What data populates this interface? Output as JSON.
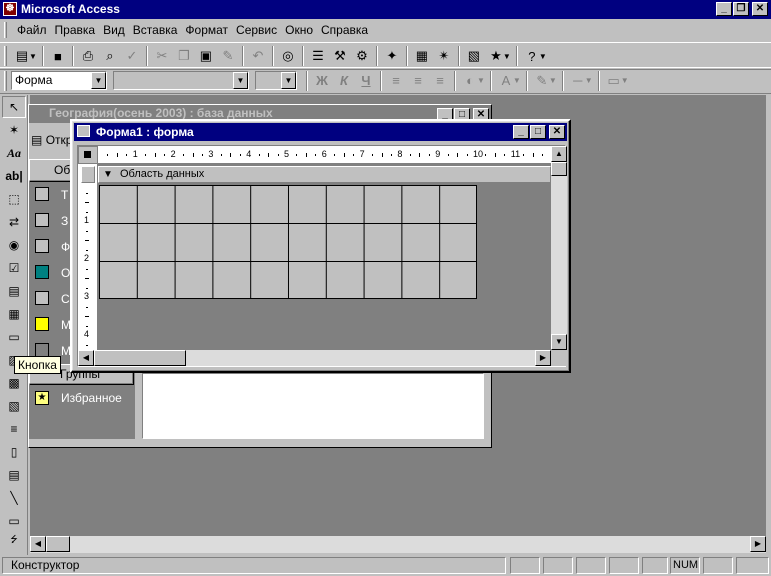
{
  "app": {
    "title": "Microsoft Access"
  },
  "menu": [
    "Файл",
    "Правка",
    "Вид",
    "Вставка",
    "Формат",
    "Сервис",
    "Окно",
    "Справка"
  ],
  "format_toolbar": {
    "object_combo": "Форма",
    "font_combo": "",
    "size_combo": "",
    "bold": "Ж",
    "italic": "К",
    "underline": "Ч"
  },
  "db_window": {
    "title": "География(осень 2003) : база данных",
    "open_button": "Откр",
    "objects_header": "Об",
    "objects": [
      "Т",
      "З",
      "Ф",
      "О",
      "С",
      "М",
      "М"
    ],
    "groups_label": "Группы",
    "favorites_label": "Избранное"
  },
  "form_window": {
    "title": "Форма1 : форма",
    "section_label": "Область данных",
    "hruler": [
      "1",
      "2",
      "3",
      "4",
      "5",
      "6",
      "7",
      "8",
      "9",
      "10",
      "11"
    ],
    "vruler": [
      "1",
      "2",
      "3",
      "4"
    ]
  },
  "toolbox": {
    "tooltip": "Кнопка"
  },
  "statusbar": {
    "text": "Конструктор",
    "num": "NUM"
  }
}
